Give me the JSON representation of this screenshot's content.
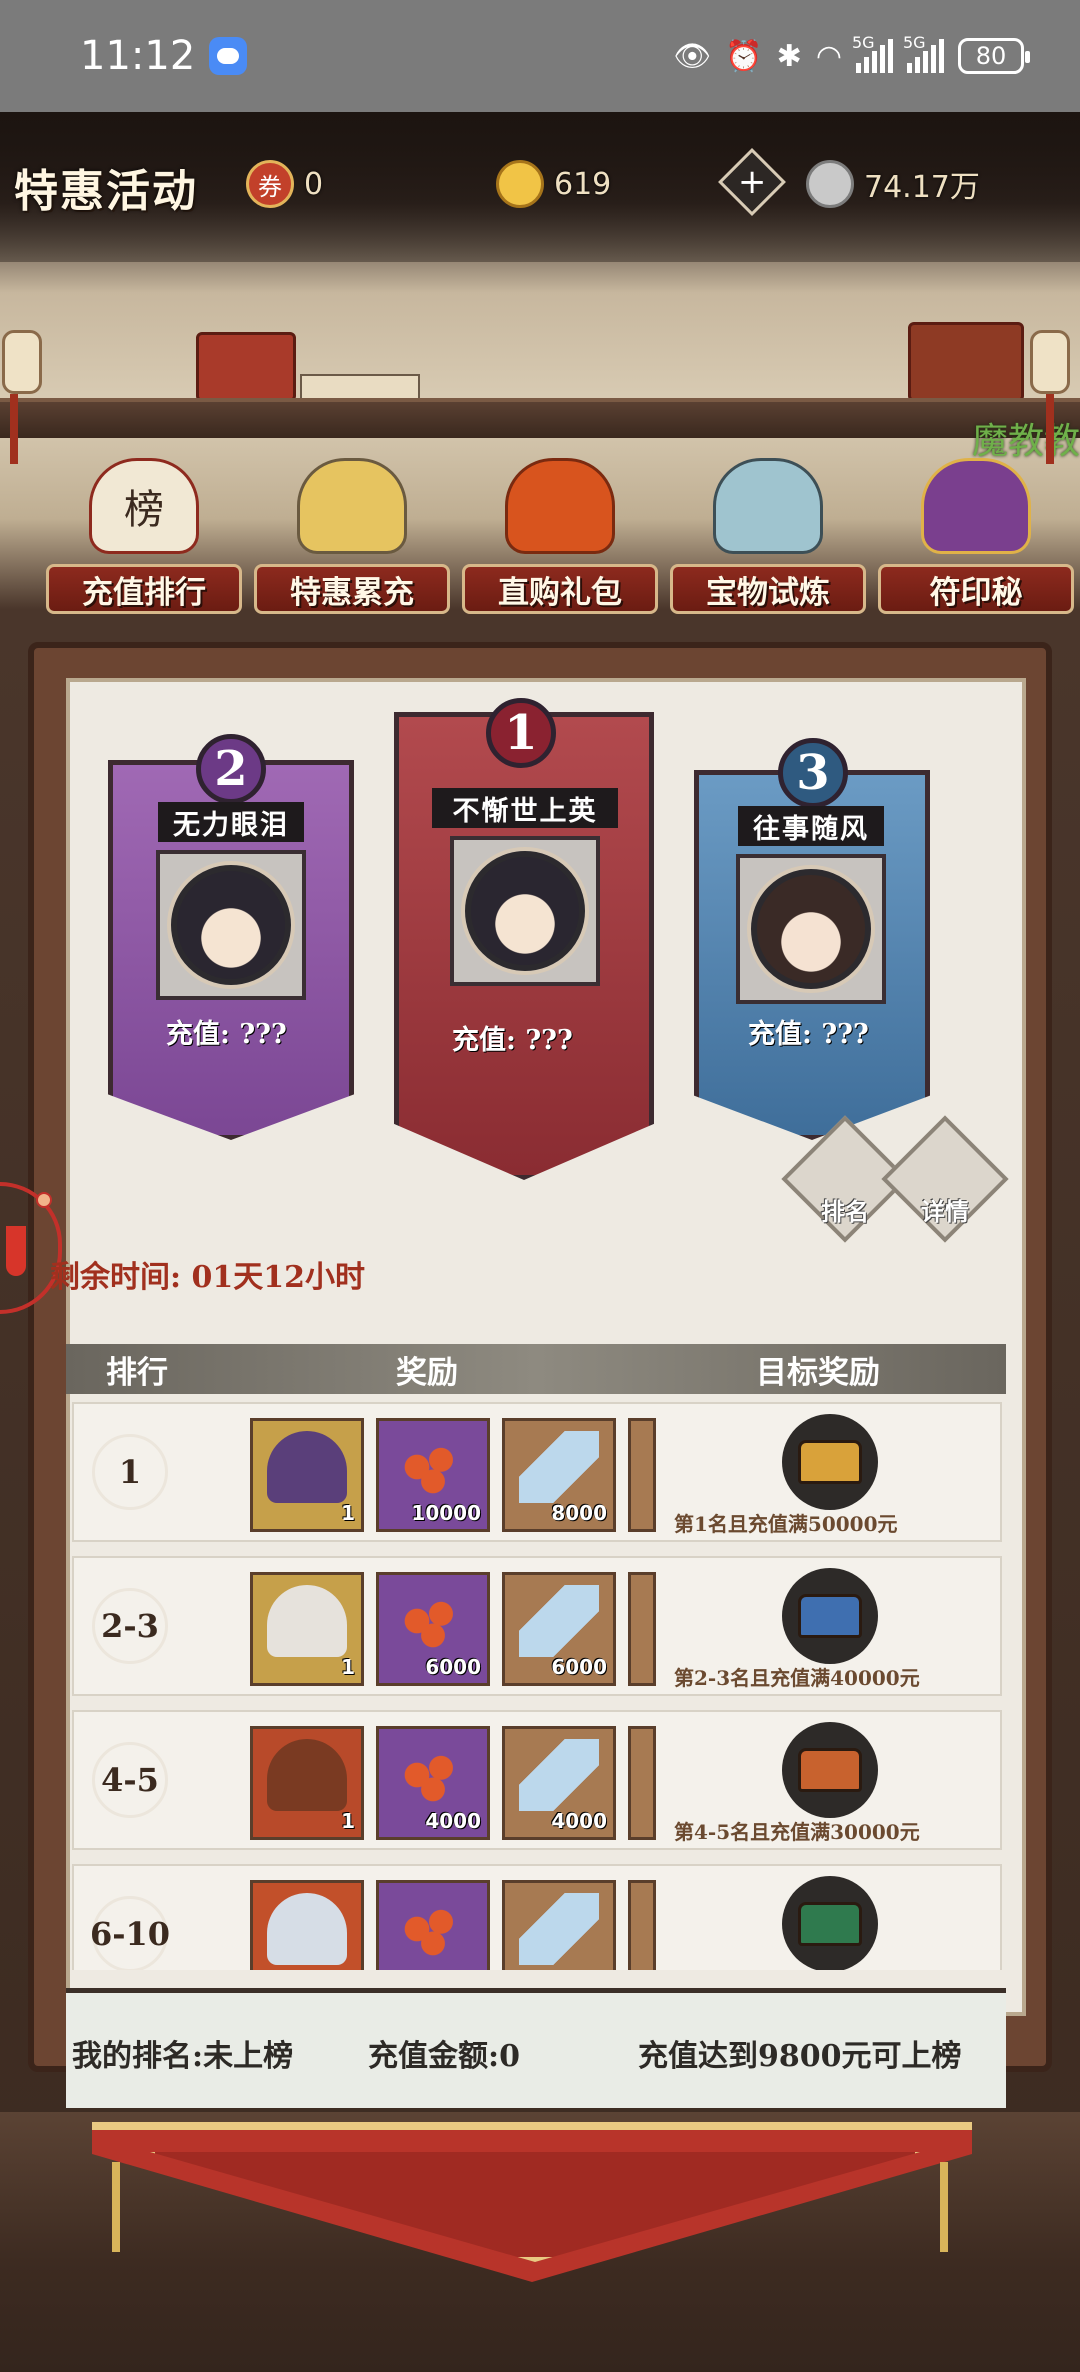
{
  "status_bar": {
    "time": "11:12",
    "network1": "5G",
    "network2": "5G",
    "battery": "80"
  },
  "header": {
    "title": "特惠活动",
    "resource_scroll": "0",
    "resource_gold": "619",
    "resource_silver": "74.17万",
    "side_text": "魔教教"
  },
  "tabs": [
    {
      "label": "充值排行",
      "art": "榜"
    },
    {
      "label": "特惠累充",
      "art": ""
    },
    {
      "label": "直购礼包",
      "art": ""
    },
    {
      "label": "宝物试炼",
      "art": ""
    },
    {
      "label": "符印秘",
      "art": ""
    }
  ],
  "podium": [
    {
      "rank": "1",
      "name": "不惭世上英",
      "recharge": "充值: ???"
    },
    {
      "rank": "2",
      "name": "无力眼泪",
      "recharge": "充值: ???"
    },
    {
      "rank": "3",
      "name": "往事随风",
      "recharge": "充值: ???"
    }
  ],
  "remaining_time": "剩余时间: 01天12小时",
  "buttons": {
    "ranking": "排名",
    "details": "详情"
  },
  "table": {
    "headers": [
      "排行",
      "奖励",
      "目标奖励"
    ],
    "rows": [
      {
        "rank": "1",
        "hero_qty": "1",
        "orbs_qty": "10000",
        "crystal_qty": "8000",
        "goal": "第1名且充值满50000元",
        "chest_color": "#d9a23a"
      },
      {
        "rank": "2-3",
        "hero_qty": "1",
        "orbs_qty": "6000",
        "crystal_qty": "6000",
        "goal": "第2-3名且充值满40000元",
        "chest_color": "#3f6fb0"
      },
      {
        "rank": "4-5",
        "hero_qty": "1",
        "orbs_qty": "4000",
        "crystal_qty": "4000",
        "goal": "第4-5名且充值满30000元",
        "chest_color": "#c8622e"
      },
      {
        "rank": "6-10",
        "hero_qty": "",
        "orbs_qty": "",
        "crystal_qty": "",
        "goal": "",
        "chest_color": "#2f7a4e"
      }
    ]
  },
  "my_rank": {
    "rank": "我的排名:未上榜",
    "amount": "充值金额:0",
    "hint": "充值达到9800元可上榜"
  }
}
